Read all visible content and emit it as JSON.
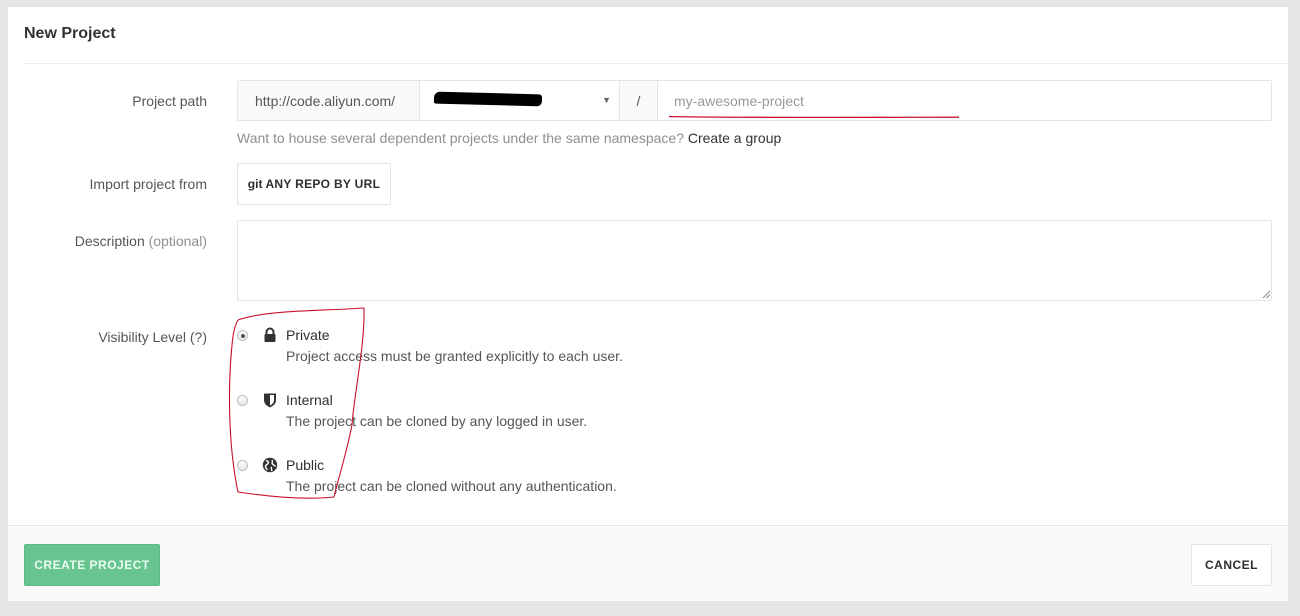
{
  "panel": {
    "title": "New Project"
  },
  "project_path": {
    "label": "Project path",
    "prefix": "http://code.aliyun.com/",
    "separator": "/",
    "placeholder": "my-awesome-project",
    "help_text": "Want to house several dependent projects under the same namespace?",
    "help_link": "Create a group"
  },
  "import": {
    "label": "Import project from",
    "git_mark": "git",
    "button_label": "ANY REPO BY URL"
  },
  "description": {
    "label": "Description",
    "optional": "(optional)"
  },
  "visibility": {
    "label": "Visibility Level (?)",
    "options": [
      {
        "title": "Private",
        "desc": "Project access must be granted explicitly to each user.",
        "icon": "lock-icon",
        "checked": true
      },
      {
        "title": "Internal",
        "desc": "The project can be cloned by any logged in user.",
        "icon": "shield-icon",
        "checked": false
      },
      {
        "title": "Public",
        "desc": "The project can be cloned without any authentication.",
        "icon": "globe-icon",
        "checked": false
      }
    ]
  },
  "footer": {
    "create_label": "CREATE PROJECT",
    "cancel_label": "CANCEL"
  },
  "colors": {
    "create_button": "#69c590",
    "annotation": "#c8102e"
  }
}
